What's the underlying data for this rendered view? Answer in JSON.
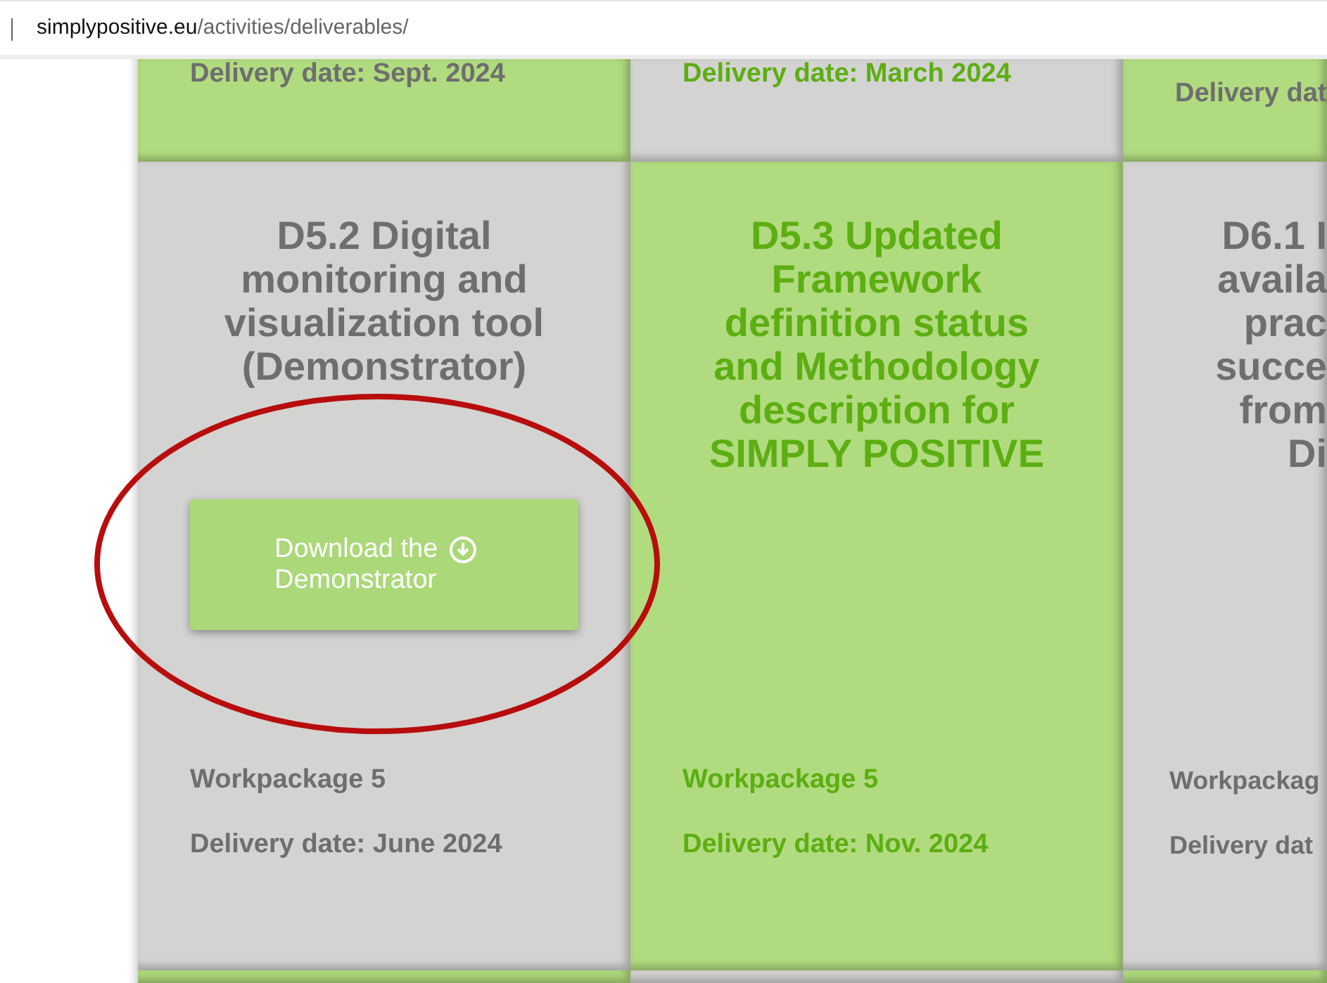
{
  "address_bar": {
    "domain": "simplypositive.eu",
    "path": "/activities/deliverables/"
  },
  "rows": [
    {
      "cells": [
        {
          "highlighted": true,
          "accent_text": false,
          "date": "Delivery date: Sept. 2024"
        },
        {
          "highlighted": false,
          "accent_text": true,
          "date": "Delivery date: March 2024"
        },
        {
          "highlighted": true,
          "accent_text": false,
          "date": "Delivery dat"
        }
      ]
    },
    {
      "cells": [
        {
          "highlighted": false,
          "accent_text": false,
          "title_lines": [
            "D5.2 Digital",
            "monitoring and",
            "visualization tool",
            "(Demonstrator)"
          ],
          "button": {
            "label_lines": [
              "Download the",
              "Demonstrator"
            ]
          },
          "annotation": {
            "kind": "ellipse",
            "color": "#b80d0d"
          },
          "workpackage": "Workpackage 5",
          "date": "Delivery date: June 2024"
        },
        {
          "highlighted": true,
          "accent_text": true,
          "title_lines": [
            "D5.3 Updated",
            "Framework",
            "definition status",
            "and Methodology",
            "description for",
            "SIMPLY POSITIVE"
          ],
          "workpackage": "Workpackage 5",
          "date": "Delivery date: Nov. 2024"
        },
        {
          "highlighted": false,
          "accent_text": false,
          "title_lines": [
            "D6.1 I",
            "availa",
            "prac",
            "succe",
            "from",
            "Di"
          ],
          "workpackage": "Workpackag",
          "date": "Delivery dat"
        }
      ]
    },
    {
      "cells": [
        {
          "highlighted": true
        },
        {
          "highlighted": false
        },
        {
          "highlighted": true
        }
      ]
    }
  ]
}
